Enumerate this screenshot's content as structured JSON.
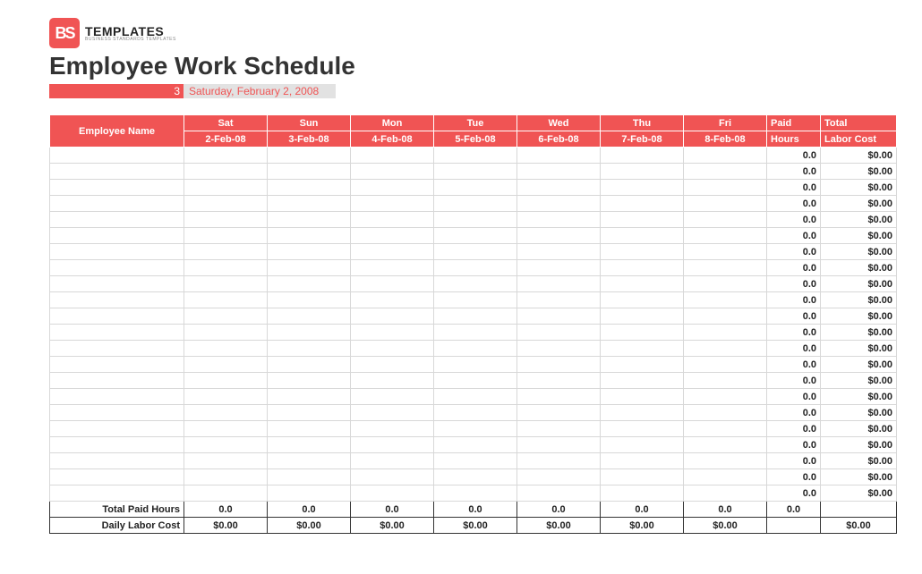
{
  "logo": {
    "badge": "BS",
    "line1": "TEMPLATES",
    "line2": "BUSINESS STANDARDS TEMPLATES"
  },
  "title": "Employee Work Schedule",
  "date": {
    "num": "3",
    "string": "Saturday, February 2, 2008"
  },
  "headers": {
    "employee": "Employee Name",
    "days": [
      {
        "name": "Sat",
        "date": "2-Feb-08"
      },
      {
        "name": "Sun",
        "date": "3-Feb-08"
      },
      {
        "name": "Mon",
        "date": "4-Feb-08"
      },
      {
        "name": "Tue",
        "date": "5-Feb-08"
      },
      {
        "name": "Wed",
        "date": "6-Feb-08"
      },
      {
        "name": "Thu",
        "date": "7-Feb-08"
      },
      {
        "name": "Fri",
        "date": "8-Feb-08"
      }
    ],
    "paid1": "Paid",
    "paid2": "Hours",
    "total1": "Total",
    "total2": "Labor Cost"
  },
  "rows": [
    {
      "paid": "0.0",
      "cost": "$0.00"
    },
    {
      "paid": "0.0",
      "cost": "$0.00"
    },
    {
      "paid": "0.0",
      "cost": "$0.00"
    },
    {
      "paid": "0.0",
      "cost": "$0.00"
    },
    {
      "paid": "0.0",
      "cost": "$0.00"
    },
    {
      "paid": "0.0",
      "cost": "$0.00"
    },
    {
      "paid": "0.0",
      "cost": "$0.00"
    },
    {
      "paid": "0.0",
      "cost": "$0.00"
    },
    {
      "paid": "0.0",
      "cost": "$0.00"
    },
    {
      "paid": "0.0",
      "cost": "$0.00"
    },
    {
      "paid": "0.0",
      "cost": "$0.00"
    },
    {
      "paid": "0.0",
      "cost": "$0.00"
    },
    {
      "paid": "0.0",
      "cost": "$0.00"
    },
    {
      "paid": "0.0",
      "cost": "$0.00"
    },
    {
      "paid": "0.0",
      "cost": "$0.00"
    },
    {
      "paid": "0.0",
      "cost": "$0.00"
    },
    {
      "paid": "0.0",
      "cost": "$0.00"
    },
    {
      "paid": "0.0",
      "cost": "$0.00"
    },
    {
      "paid": "0.0",
      "cost": "$0.00"
    },
    {
      "paid": "0.0",
      "cost": "$0.00"
    },
    {
      "paid": "0.0",
      "cost": "$0.00"
    },
    {
      "paid": "0.0",
      "cost": "$0.00"
    }
  ],
  "footer": {
    "total_hours_label": "Total Paid Hours",
    "total_hours": [
      "0.0",
      "0.0",
      "0.0",
      "0.0",
      "0.0",
      "0.0",
      "0.0",
      "0.0",
      ""
    ],
    "daily_cost_label": "Daily Labor Cost",
    "daily_cost": [
      "$0.00",
      "$0.00",
      "$0.00",
      "$0.00",
      "$0.00",
      "$0.00",
      "$0.00",
      "",
      "$0.00"
    ]
  },
  "colors": {
    "accent": "#f05454"
  }
}
